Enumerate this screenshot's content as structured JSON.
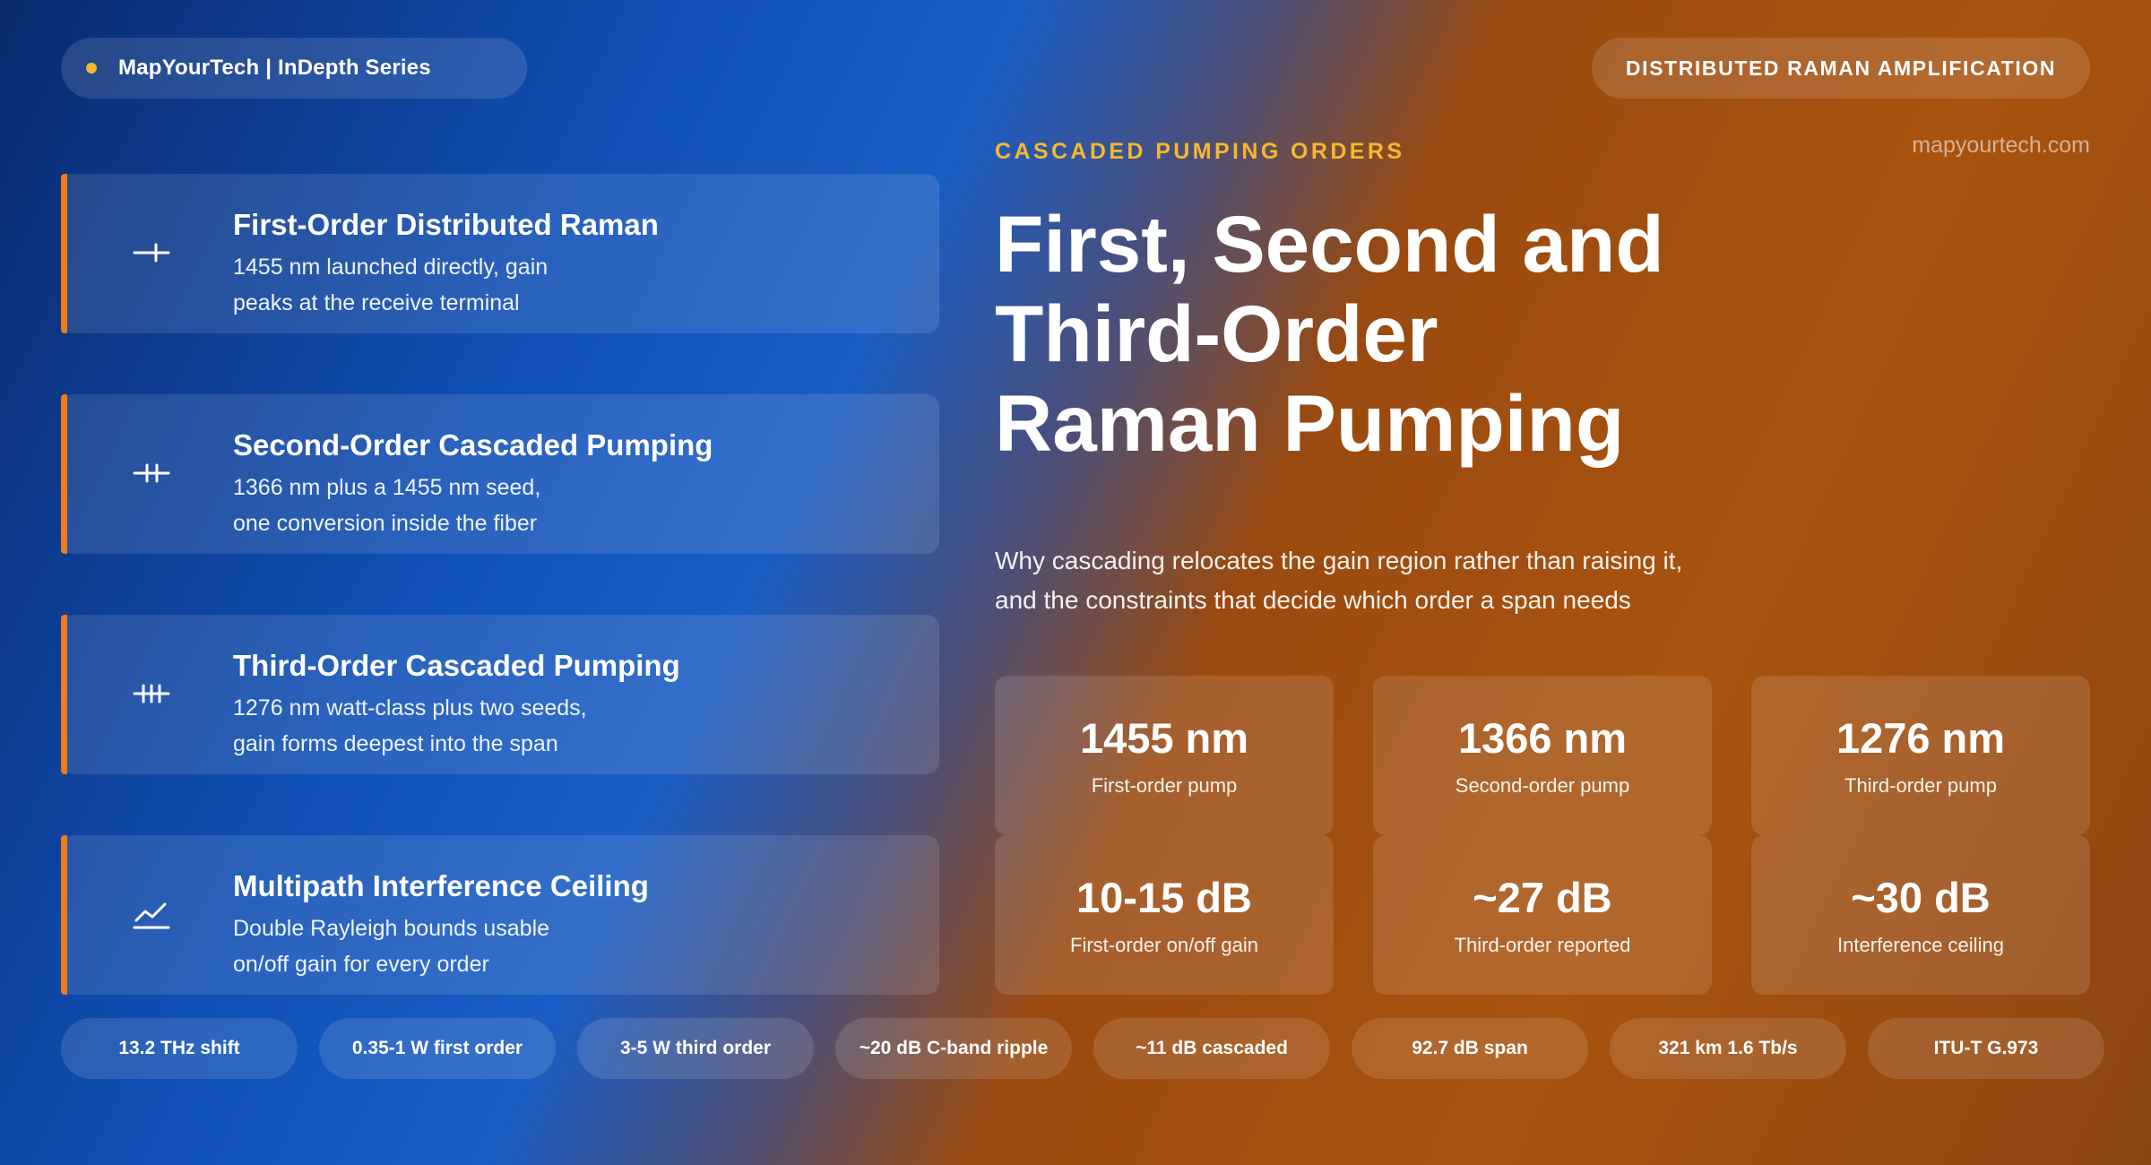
{
  "header": {
    "brand": "MapYourTech | InDepth Series",
    "series": "DISTRIBUTED RAMAN AMPLIFICATION",
    "website": "mapyourtech.com"
  },
  "cards": [
    {
      "title": "First-Order Distributed Raman",
      "desc_line1": "1455 nm launched directly, gain",
      "desc_line2": "peaks at the receive terminal",
      "icon": "single-arrow-icon"
    },
    {
      "title": "Second-Order Cascaded Pumping",
      "desc_line1": "1366 nm plus a 1455 nm seed,",
      "desc_line2": "one conversion inside the fiber",
      "icon": "double-arrow-icon"
    },
    {
      "title": "Third-Order Cascaded Pumping",
      "desc_line1": "1276 nm watt-class plus two seeds,",
      "desc_line2": "gain forms deepest into the span",
      "icon": "triple-arrow-icon"
    },
    {
      "title": "Multipath Interference Ceiling",
      "desc_line1": "Double Rayleigh bounds usable",
      "desc_line2": "on/off gain for every order",
      "icon": "line-chart-icon"
    }
  ],
  "hero": {
    "kicker": "CASCADED PUMPING ORDERS",
    "headline_line1": "First, Second and",
    "headline_line2": "Third-Order",
    "headline_line3": "Raman Pumping",
    "subtitle_line1": "Why cascading relocates the gain region rather than raising it,",
    "subtitle_line2": "and the constraints that decide which order a span needs"
  },
  "stats": [
    {
      "value": "1455 nm",
      "label": "First-order pump"
    },
    {
      "value": "1366 nm",
      "label": "Second-order pump"
    },
    {
      "value": "1276 nm",
      "label": "Third-order pump"
    },
    {
      "value": "10-15 dB",
      "label": "First-order on/off gain"
    },
    {
      "value": "~27 dB",
      "label": "Third-order reported"
    },
    {
      "value": "~30 dB",
      "label": "Interference ceiling"
    }
  ],
  "chips": [
    "13.2 THz shift",
    "0.35-1 W first order",
    "3-5 W third order",
    "~20 dB C-band ripple",
    "~11 dB cascaded",
    "92.7 dB span",
    "321 km 1.6 Tb/s",
    "ITU-T G.973"
  ],
  "colors": {
    "accent_bar": "#f27a1a",
    "kicker": "#f5b82e",
    "brand_dot": "#f5b82e"
  }
}
